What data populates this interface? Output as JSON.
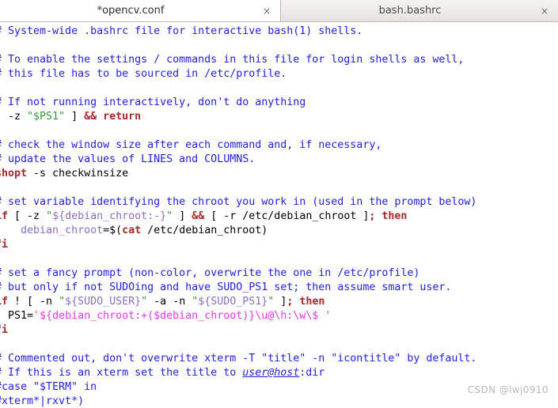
{
  "window": {
    "app": "gedit",
    "title": "*opencv.conf"
  },
  "tabs": [
    {
      "label": "*opencv.conf",
      "close": "×",
      "active": true,
      "modified": true
    },
    {
      "label": "bash.bashrc",
      "close": "×",
      "active": false,
      "modified": false
    }
  ],
  "colors": {
    "comment": "#2222dd",
    "keyword": "#a52a2a",
    "string": "#3a9a3a",
    "variable": "#8a70c0",
    "single_quote_string": "#e838e8",
    "plain": "#000000",
    "editor_background": "#ffffff",
    "tabbar_background": "#d9d6d2",
    "active_tab_background": "#ffffff",
    "watermark": "#b9b9b9"
  },
  "editor": {
    "language": "sh",
    "horizontal_scroll_chars": 1,
    "note_first_char_clipped": true,
    "lines": [
      {
        "n": 1,
        "tokens": [
          {
            "t": "cmt",
            "v": "# System-wide .bashrc file for interactive bash(1) shells."
          }
        ]
      },
      {
        "n": 2,
        "tokens": []
      },
      {
        "n": 3,
        "tokens": [
          {
            "t": "cmt",
            "v": "# To enable the settings / commands in this file for login shells as well,"
          }
        ]
      },
      {
        "n": 4,
        "tokens": [
          {
            "t": "cmt",
            "v": "# this file has to be sourced in /etc/profile."
          }
        ]
      },
      {
        "n": 5,
        "tokens": []
      },
      {
        "n": 6,
        "tokens": [
          {
            "t": "cmt",
            "v": "# If not running interactively, don't do anything"
          }
        ]
      },
      {
        "n": 7,
        "tokens": [
          {
            "t": "pln",
            "v": "[ -z "
          },
          {
            "t": "str",
            "v": "\"$PS1\""
          },
          {
            "t": "pln",
            "v": " ] "
          },
          {
            "t": "kw",
            "v": "&&"
          },
          {
            "t": "kw",
            "v": " return"
          }
        ]
      },
      {
        "n": 8,
        "tokens": []
      },
      {
        "n": 9,
        "tokens": [
          {
            "t": "cmt",
            "v": "# check the window size after each command and, if necessary,"
          }
        ]
      },
      {
        "n": 10,
        "tokens": [
          {
            "t": "cmt",
            "v": "# update the values of LINES and COLUMNS."
          }
        ]
      },
      {
        "n": 11,
        "tokens": [
          {
            "t": "kw",
            "v": "shopt"
          },
          {
            "t": "pln",
            "v": " -s checkwinsize"
          }
        ]
      },
      {
        "n": 12,
        "tokens": []
      },
      {
        "n": 13,
        "tokens": [
          {
            "t": "cmt",
            "v": "# set variable identifying the chroot you work in (used in the prompt below)"
          }
        ]
      },
      {
        "n": 14,
        "tokens": [
          {
            "t": "kw",
            "v": "if"
          },
          {
            "t": "pln",
            "v": " [ -z "
          },
          {
            "t": "str",
            "v": "\""
          },
          {
            "t": "var",
            "v": "${debian_chroot:-}"
          },
          {
            "t": "str",
            "v": "\""
          },
          {
            "t": "pln",
            "v": " ] "
          },
          {
            "t": "kw",
            "v": "&&"
          },
          {
            "t": "pln",
            "v": " [ -r /etc/debian_chroot ]"
          },
          {
            "t": "kw",
            "v": ";"
          },
          {
            "t": "kw",
            "v": " then"
          }
        ]
      },
      {
        "n": 15,
        "tokens": [
          {
            "t": "pln",
            "v": "    "
          },
          {
            "t": "var",
            "v": "debian_chroot"
          },
          {
            "t": "pln",
            "v": "=$("
          },
          {
            "t": "kw",
            "v": "cat"
          },
          {
            "t": "pln",
            "v": " /etc/debian_chroot)"
          }
        ]
      },
      {
        "n": 16,
        "tokens": [
          {
            "t": "kw",
            "v": "fi"
          }
        ]
      },
      {
        "n": 17,
        "tokens": []
      },
      {
        "n": 18,
        "tokens": [
          {
            "t": "cmt",
            "v": "# set a fancy prompt (non-color, overwrite the one in /etc/profile)"
          }
        ]
      },
      {
        "n": 19,
        "tokens": [
          {
            "t": "cmt",
            "v": "# but only if not SUDOing and have SUDO_PS1 set; then assume smart user."
          }
        ]
      },
      {
        "n": 20,
        "tokens": [
          {
            "t": "kw",
            "v": "if"
          },
          {
            "t": "pln",
            "v": " ! [ -n "
          },
          {
            "t": "str",
            "v": "\""
          },
          {
            "t": "var",
            "v": "${SUDO_USER}"
          },
          {
            "t": "str",
            "v": "\""
          },
          {
            "t": "pln",
            "v": " -a -n "
          },
          {
            "t": "str",
            "v": "\""
          },
          {
            "t": "var",
            "v": "${SUDO_PS1}"
          },
          {
            "t": "str",
            "v": "\""
          },
          {
            "t": "pln",
            "v": " ]"
          },
          {
            "t": "kw",
            "v": ";"
          },
          {
            "t": "kw",
            "v": " then"
          }
        ]
      },
      {
        "n": 21,
        "tokens": [
          {
            "t": "pln",
            "v": "  PS1="
          },
          {
            "t": "sq",
            "v": "'${debian_chroot:+($debian_chroot)}\\u@\\h:\\w\\$ '"
          }
        ]
      },
      {
        "n": 22,
        "tokens": [
          {
            "t": "kw",
            "v": "fi"
          }
        ]
      },
      {
        "n": 23,
        "tokens": []
      },
      {
        "n": 24,
        "tokens": [
          {
            "t": "cmt",
            "v": "# Commented out, don't overwrite xterm -T \"title\" -n \"icontitle\" by default."
          }
        ]
      },
      {
        "n": 25,
        "tokens": [
          {
            "t": "cmt",
            "v": "# If this is an xterm set the title to "
          },
          {
            "t": "cmt mail",
            "v": "user@host"
          },
          {
            "t": "cmt",
            "v": ":dir"
          }
        ]
      },
      {
        "n": 26,
        "tokens": [
          {
            "t": "cmt",
            "v": "#case \"$TERM\" in"
          }
        ]
      },
      {
        "n": 27,
        "tokens": [
          {
            "t": "cmt",
            "v": "#xterm*|rxvt*)"
          }
        ]
      }
    ]
  },
  "watermark": {
    "text": "CSDN @lwj0910"
  }
}
